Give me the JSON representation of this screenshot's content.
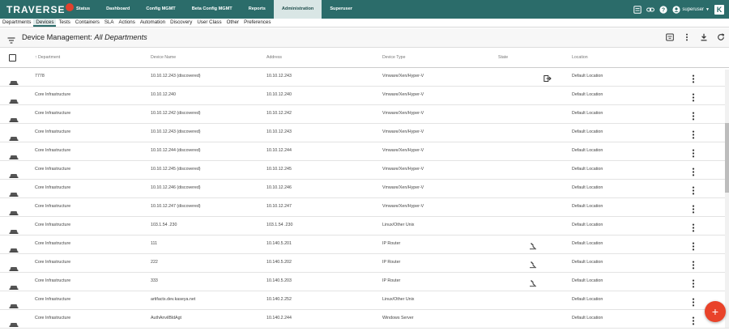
{
  "app": {
    "logo_text": "TRAVERSE"
  },
  "topnav": [
    {
      "label": "Status",
      "active": false
    },
    {
      "label": "Dashboard",
      "active": false
    },
    {
      "label": "Config MGMT",
      "active": false
    },
    {
      "label": "Beta Config MGMT",
      "active": false
    },
    {
      "label": "Reports",
      "active": false
    },
    {
      "label": "Administration",
      "active": true
    },
    {
      "label": "Superuser",
      "active": false
    }
  ],
  "topright": {
    "username": "superuser",
    "badge": "K",
    "icons": [
      "feed-icon",
      "link-icon",
      "help-icon",
      "user-icon"
    ]
  },
  "subnav": [
    {
      "label": "Departments",
      "active": false
    },
    {
      "label": "Devices",
      "active": true
    },
    {
      "label": "Tests",
      "active": false
    },
    {
      "label": "Containers",
      "active": false
    },
    {
      "label": "SLA",
      "active": false
    },
    {
      "label": "Actions",
      "active": false
    },
    {
      "label": "Automation",
      "active": false
    },
    {
      "label": "Discovery",
      "active": false
    },
    {
      "label": "User Class",
      "active": false
    },
    {
      "label": "Other",
      "active": false
    },
    {
      "label": "Preferences",
      "active": false
    }
  ],
  "header": {
    "title_prefix": "Device Management:",
    "title_scope": "All Departments"
  },
  "table": {
    "columns": {
      "department": "Department",
      "device_name": "Device Name",
      "address": "Address",
      "device_type": "Device Type",
      "state": "State",
      "location": "Location"
    },
    "sort_indicator": "↑",
    "rows": [
      {
        "department": "7778",
        "name": "10.10.12.243 (discovered)",
        "address": "10.10.12.243",
        "type": "Vmware/Xen/Hyper-V",
        "state": "exit",
        "location": "Default Location"
      },
      {
        "department": "Core Infrastructure",
        "name": "10.10.12.240",
        "address": "10.10.12.240",
        "type": "Vmware/Xen/Hyper-V",
        "state": "",
        "location": "Default Location"
      },
      {
        "department": "Core Infrastructure",
        "name": "10.10.12.242 (discovered)",
        "address": "10.10.12.242",
        "type": "Vmware/Xen/Hyper-V",
        "state": "",
        "location": "Default Location"
      },
      {
        "department": "Core Infrastructure",
        "name": "10.10.12.243 (discovered)",
        "address": "10.10.12.243",
        "type": "Vmware/Xen/Hyper-V",
        "state": "",
        "location": "Default Location"
      },
      {
        "department": "Core Infrastructure",
        "name": "10.10.12.244 (discovered)",
        "address": "10.10.12.244",
        "type": "Vmware/Xen/Hyper-V",
        "state": "",
        "location": "Default Location"
      },
      {
        "department": "Core Infrastructure",
        "name": "10.10.12.245 (discovered)",
        "address": "10.10.12.245",
        "type": "Vmware/Xen/Hyper-V",
        "state": "",
        "location": "Default Location"
      },
      {
        "department": "Core Infrastructure",
        "name": "10.10.12.246 (discovered)",
        "address": "10.10.12.246",
        "type": "Vmware/Xen/Hyper-V",
        "state": "",
        "location": "Default Location"
      },
      {
        "department": "Core Infrastructure",
        "name": "10.10.12.247 (discovered)",
        "address": "10.10.12.247",
        "type": "Vmware/Xen/Hyper-V",
        "state": "",
        "location": "Default Location"
      },
      {
        "department": "Core Infrastructure",
        "name": "103.1.54 .230",
        "address": "103.1.54 .230",
        "type": "Linux/Other Unix",
        "state": "",
        "location": "Default Location"
      },
      {
        "department": "Core Infrastructure",
        "name": "111",
        "address": "10.140.5.201",
        "type": "IP Router",
        "state": "maintenance",
        "location": "Default Location"
      },
      {
        "department": "Core Infrastructure",
        "name": "222",
        "address": "10.140.5.202",
        "type": "IP Router",
        "state": "maintenance",
        "location": "Default Location"
      },
      {
        "department": "Core Infrastructure",
        "name": "333",
        "address": "10.140.5.203",
        "type": "IP Router",
        "state": "maintenance",
        "location": "Default Location"
      },
      {
        "department": "Core Infrastructure",
        "name": "artifacts.dev.kaseya.net",
        "address": "10.140.2.252",
        "type": "Linux/Other Unix",
        "state": "",
        "location": "Default Location"
      },
      {
        "department": "Core Infrastructure",
        "name": "AuthAnvilBldAgt",
        "address": "10.140.2.244",
        "type": "Windows Server",
        "state": "",
        "location": "Default Location"
      }
    ]
  },
  "fab": {
    "label": "+"
  },
  "colors": {
    "topbar": "#2b6c6a",
    "fab": "#e9432a",
    "logo_accent": "#e0412e"
  }
}
